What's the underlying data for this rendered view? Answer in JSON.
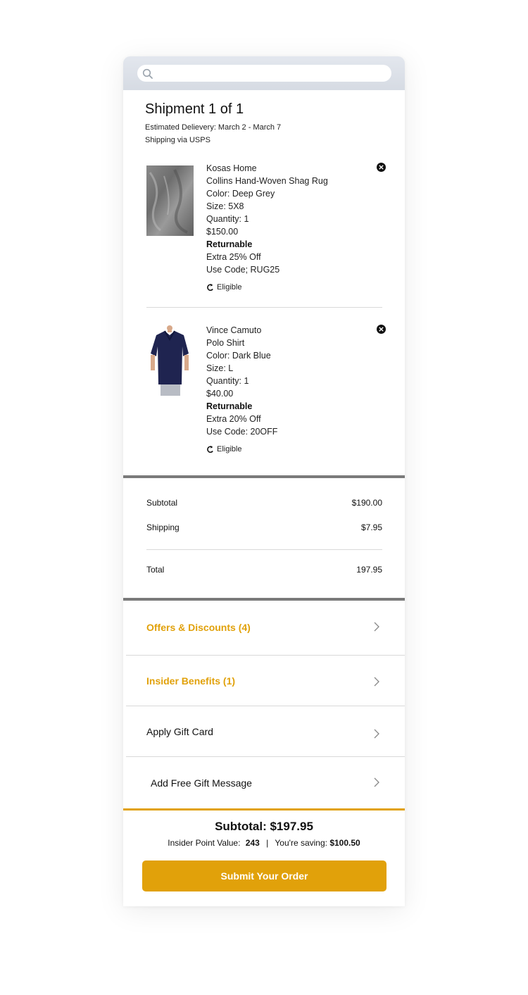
{
  "search": {
    "placeholder": ""
  },
  "shipment": {
    "title": "Shipment 1 of 1",
    "estimated_delivery": "Estimated Delievery: March 2 - March 7",
    "shipping_via": "Shipping via USPS"
  },
  "items": [
    {
      "brand": "Kosas Home",
      "name": "Collins Hand-Woven Shag Rug",
      "color": "Color: Deep Grey",
      "size": "Size: 5X8",
      "quantity": "Quantity: 1",
      "price": "$150.00",
      "returnable": "Returnable",
      "offer": "Extra 25% Off",
      "code": "Use Code; RUG25",
      "eligible": "Eligible"
    },
    {
      "brand": "Vince Camuto",
      "name": "Polo Shirt",
      "color": "Color: Dark Blue",
      "size": "Size: L",
      "quantity": "Quantity: 1",
      "price": "$40.00",
      "returnable": "Returnable",
      "offer": "Extra 20% Off",
      "code": "Use Code: 20OFF",
      "eligible": "Eligible"
    }
  ],
  "summary": {
    "subtotal_label": "Subtotal",
    "subtotal_value": "$190.00",
    "shipping_label": "Shipping",
    "shipping_value": "$7.95",
    "total_label": "Total",
    "total_value": "197.95"
  },
  "menu": {
    "offers": "Offers & Discounts (4)",
    "insider": "Insider Benefits (1)",
    "gift_card": "Apply Gift Card",
    "gift_message": "Add Free Gift Message"
  },
  "footer": {
    "subtotal": "Subtotal: $197.95",
    "insider_label": "Insider Point Value:",
    "insider_points": "243",
    "separator": "|",
    "saving_label": "You're saving:",
    "saving_value": "$100.50",
    "submit_label": "Submit Your Order"
  },
  "colors": {
    "accent": "#e1a10a",
    "divider": "#7a7a7a"
  }
}
